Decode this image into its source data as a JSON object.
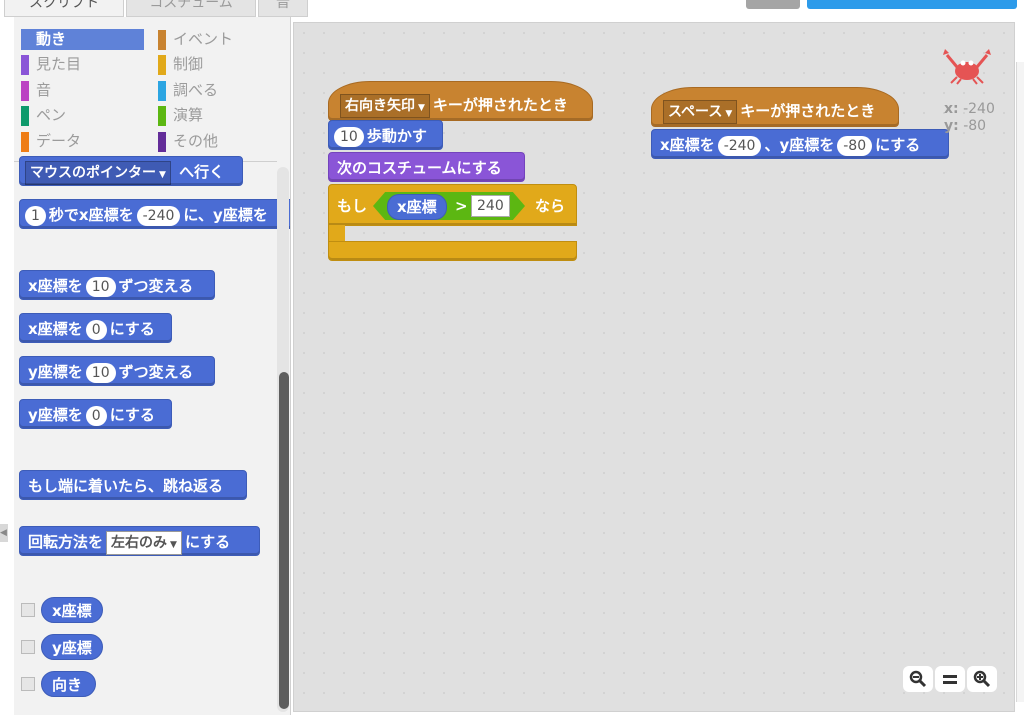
{
  "tabs": [
    {
      "label": "スクリプト"
    },
    {
      "label": "コスチューム"
    },
    {
      "label": "音"
    }
  ],
  "categories": [
    {
      "label": "動き",
      "color": "#4a6cd4",
      "selected": true
    },
    {
      "label": "イベント",
      "color": "#c88330"
    },
    {
      "label": "見た目",
      "color": "#8a55d7"
    },
    {
      "label": "制御",
      "color": "#e1a91a"
    },
    {
      "label": "音",
      "color": "#bb42c3"
    },
    {
      "label": "調べる",
      "color": "#2ca5e2"
    },
    {
      "label": "ペン",
      "color": "#0e9a6c"
    },
    {
      "label": "演算",
      "color": "#5cb712"
    },
    {
      "label": "データ",
      "color": "#ee7d16"
    },
    {
      "label": "その他",
      "color": "#632d99"
    }
  ],
  "palette": {
    "goto_pointer": {
      "label": "マウスのポインター",
      "suffix": "へ行く"
    },
    "glide": {
      "secs": "1",
      "text1": "秒でx座標を",
      "x": "-240",
      "text2": "に、y座標を"
    },
    "change_x": {
      "text1": "x座標を",
      "value": "10",
      "text2": "ずつ変える"
    },
    "set_x": {
      "text1": "x座標を",
      "value": "0",
      "text2": "にする"
    },
    "change_y": {
      "text1": "y座標を",
      "value": "10",
      "text2": "ずつ変える"
    },
    "set_y": {
      "text1": "y座標を",
      "value": "0",
      "text2": "にする"
    },
    "bounce": {
      "label": "もし端に着いたら、跳ね返る"
    },
    "rotation": {
      "text1": "回転方法を",
      "value": "左右のみ",
      "text2": "にする"
    },
    "reporters": [
      "x座標",
      "y座標",
      "向き"
    ]
  },
  "script1": {
    "hat_key": "右向き矢印",
    "hat_text": "キーが押されたとき",
    "move_steps": "10",
    "move_text": "歩動かす",
    "next_costume": "次のコスチュームにする",
    "if_text": "もし",
    "if_reporter": "x座標",
    "if_op": ">",
    "if_value": "240",
    "then_text": "なら"
  },
  "script2": {
    "hat_key": "スペース",
    "hat_text": "キーが押されたとき",
    "text1": "x座標を",
    "x": "-240",
    "text2": "、y座標を",
    "y": "-80",
    "text3": "にする"
  },
  "sprite_info": {
    "x_label": "x:",
    "x": "-240",
    "y_label": "y:",
    "y": "-80"
  },
  "zoom": {
    "out": "zoom-out-icon",
    "reset": "zoom-reset-icon",
    "in": "zoom-in-icon"
  }
}
